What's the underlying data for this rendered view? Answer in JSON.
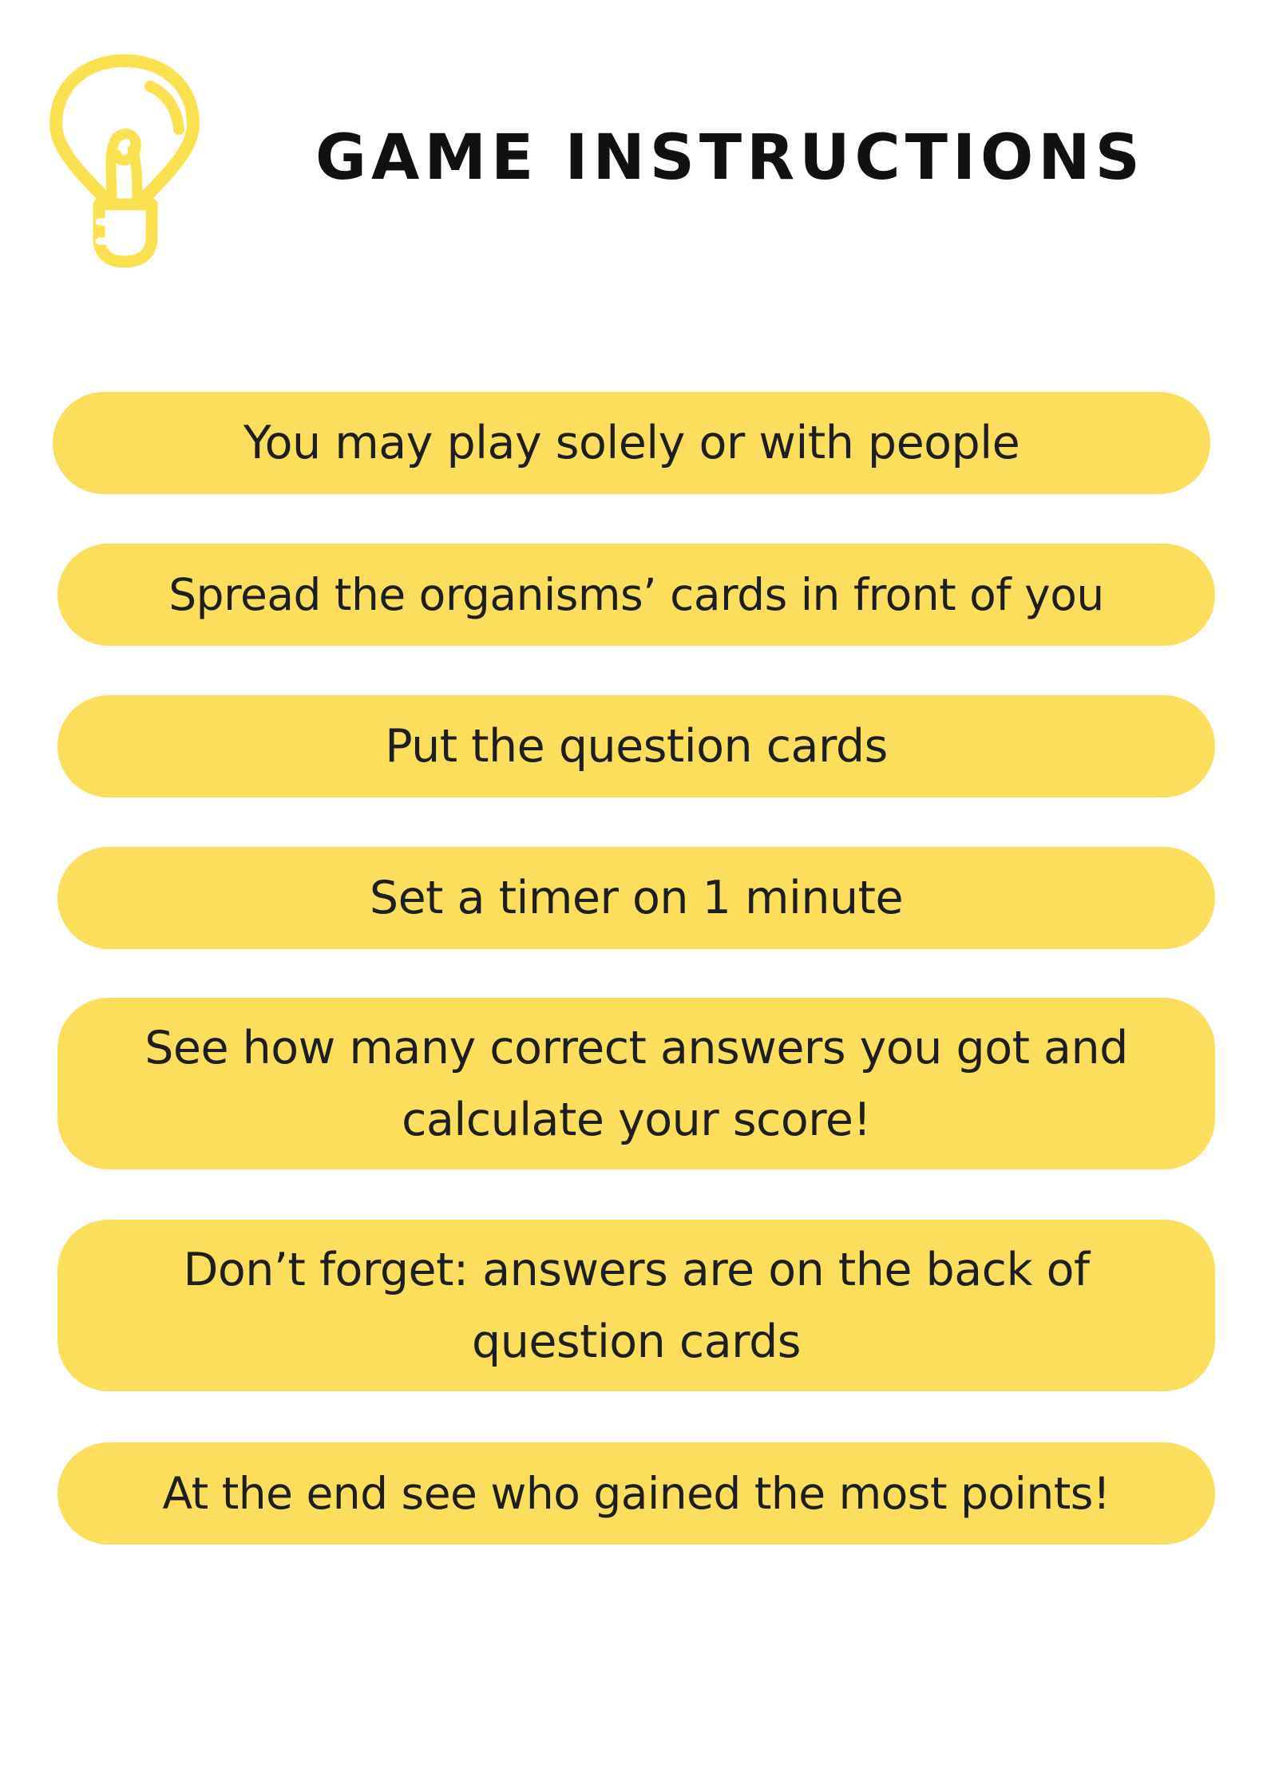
{
  "header": {
    "icon": "lightbulb-icon",
    "title": "GAME INSTRUCTIONS"
  },
  "colors": {
    "accent": "#fcdd5c",
    "icon": "#fbe14f",
    "text": "#1e1e1e"
  },
  "instructions": [
    "You may play solely or with people",
    "Spread the organisms’ cards in front of you",
    "Put the question cards",
    "Set a timer on 1 minute",
    "See how many correct answers you got and calculate your score!",
    "Don’t forget: answers are on the back of question cards",
    "At the end see who gained the most points!"
  ]
}
